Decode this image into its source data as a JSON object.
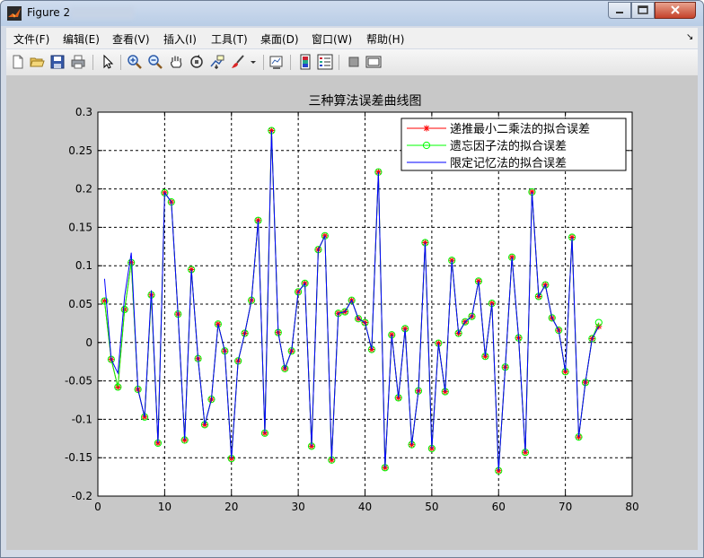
{
  "window": {
    "title": "Figure 2"
  },
  "menu": [
    {
      "label": "文件(F)"
    },
    {
      "label": "编辑(E)"
    },
    {
      "label": "查看(V)"
    },
    {
      "label": "插入(I)"
    },
    {
      "label": "工具(T)"
    },
    {
      "label": "桌面(D)"
    },
    {
      "label": "窗口(W)"
    },
    {
      "label": "帮助(H)"
    }
  ],
  "toolbar_icons": [
    "new-file-icon",
    "open-folder-icon",
    "save-icon",
    "print-icon",
    "pointer-icon",
    "zoom-in-icon",
    "zoom-out-icon",
    "pan-hand-icon",
    "rotate-3d-icon",
    "data-cursor-icon",
    "brush-icon",
    "brush-dropdown-icon",
    "link-plot-icon",
    "colorbar-icon",
    "legend-icon",
    "hide-plot-tools-icon",
    "show-plot-tools-icon"
  ],
  "colors": {
    "series1": "#ff0000",
    "series2": "#00ff00",
    "series3": "#0000ff",
    "figure_bg": "#c8c8c8",
    "axes_bg": "#ffffff"
  },
  "chart_data": {
    "type": "line",
    "title": "三种算法误差曲线图",
    "xlabel": "",
    "ylabel": "",
    "xlim": [
      0,
      80
    ],
    "ylim": [
      -0.2,
      0.3
    ],
    "xticks": [
      "0",
      "10",
      "20",
      "30",
      "40",
      "50",
      "60",
      "70",
      "80"
    ],
    "yticks": [
      "-0.2",
      "-0.15",
      "-0.1",
      "-0.05",
      "0",
      "0.05",
      "0.1",
      "0.15",
      "0.2",
      "0.25",
      "0.3"
    ],
    "grid": true,
    "legend_position": "top-right",
    "series": [
      {
        "name": "递推最小二乘法的拟合误差",
        "marker": "asterisk",
        "color": "#ff0000",
        "x": [
          1,
          2,
          3,
          4,
          5,
          6,
          7,
          8,
          9,
          10,
          11,
          12,
          13,
          14,
          15,
          16,
          17,
          18,
          19,
          20,
          21,
          22,
          23,
          24,
          25,
          26,
          27,
          28,
          29,
          30,
          31,
          32,
          33,
          34,
          35,
          36,
          37,
          38,
          39,
          40,
          41,
          42,
          43,
          44,
          45,
          46,
          47,
          48,
          49,
          50,
          51,
          52,
          53,
          54,
          55,
          56,
          57,
          58,
          59,
          60,
          61,
          62,
          63,
          64,
          65,
          66,
          67,
          68,
          69,
          70,
          71,
          72,
          73,
          74,
          75
        ],
        "y": [
          0.054,
          -0.022,
          -0.058,
          0.043,
          0.104,
          -0.061,
          -0.097,
          0.062,
          -0.131,
          0.195,
          0.183,
          0.037,
          -0.127,
          0.095,
          -0.021,
          -0.107,
          -0.074,
          0.024,
          -0.011,
          -0.151,
          -0.024,
          0.012,
          0.055,
          0.159,
          -0.118,
          0.276,
          0.013,
          -0.034,
          -0.011,
          0.066,
          0.077,
          -0.135,
          0.121,
          0.139,
          -0.153,
          0.038,
          0.04,
          0.055,
          0.031,
          0.026,
          -0.009,
          0.222,
          -0.163,
          0.01,
          -0.072,
          0.018,
          -0.133,
          -0.063,
          0.13,
          -0.138,
          -0.001,
          -0.064,
          0.107,
          0.012,
          0.027,
          0.034,
          0.08,
          -0.018,
          0.051,
          -0.167,
          -0.032,
          0.111,
          0.006,
          -0.143,
          0.196,
          0.06,
          0.075,
          0.032,
          0.016,
          -0.038,
          0.137,
          -0.123,
          -0.052,
          0.005,
          0.021
        ]
      },
      {
        "name": "遗忘因子法的拟合误差",
        "marker": "circle",
        "color": "#00ff00",
        "x": [
          1,
          2,
          3,
          4,
          5,
          6,
          7,
          8,
          9,
          10,
          11,
          12,
          13,
          14,
          15,
          16,
          17,
          18,
          19,
          20,
          21,
          22,
          23,
          24,
          25,
          26,
          27,
          28,
          29,
          30,
          31,
          32,
          33,
          34,
          35,
          36,
          37,
          38,
          39,
          40,
          41,
          42,
          43,
          44,
          45,
          46,
          47,
          48,
          49,
          50,
          51,
          52,
          53,
          54,
          55,
          56,
          57,
          58,
          59,
          60,
          61,
          62,
          63,
          64,
          65,
          66,
          67,
          68,
          69,
          70,
          71,
          72,
          73,
          74,
          75
        ],
        "y": [
          0.054,
          -0.022,
          -0.058,
          0.043,
          0.104,
          -0.061,
          -0.097,
          0.062,
          -0.131,
          0.195,
          0.183,
          0.037,
          -0.127,
          0.095,
          -0.021,
          -0.107,
          -0.074,
          0.024,
          -0.011,
          -0.151,
          -0.024,
          0.012,
          0.055,
          0.159,
          -0.118,
          0.276,
          0.013,
          -0.034,
          -0.011,
          0.066,
          0.077,
          -0.135,
          0.121,
          0.139,
          -0.153,
          0.038,
          0.04,
          0.055,
          0.031,
          0.026,
          -0.009,
          0.222,
          -0.163,
          0.01,
          -0.072,
          0.018,
          -0.133,
          -0.063,
          0.13,
          -0.138,
          -0.001,
          -0.064,
          0.107,
          0.012,
          0.027,
          0.034,
          0.08,
          -0.018,
          0.051,
          -0.167,
          -0.032,
          0.111,
          0.006,
          -0.143,
          0.196,
          0.06,
          0.075,
          0.032,
          0.016,
          -0.038,
          0.137,
          -0.123,
          -0.052,
          0.005,
          0.026
        ]
      },
      {
        "name": "限定记忆法的拟合误差",
        "marker": "none",
        "color": "#0000ff",
        "x": [
          1,
          2,
          3,
          4,
          5,
          6,
          7,
          8,
          9,
          10,
          11,
          12,
          13,
          14,
          15,
          16,
          17,
          18,
          19,
          20,
          21,
          22,
          23,
          24,
          25,
          26,
          27,
          28,
          29,
          30,
          31,
          32,
          33,
          34,
          35,
          36,
          37,
          38,
          39,
          40,
          41,
          42,
          43,
          44,
          45,
          46,
          47,
          48,
          49,
          50,
          51,
          52,
          53,
          54,
          55,
          56,
          57,
          58,
          59,
          60,
          61,
          62,
          63,
          64,
          65,
          66,
          67,
          68,
          69,
          70,
          71,
          72,
          73,
          74,
          75
        ],
        "y": [
          0.083,
          -0.022,
          -0.04,
          0.06,
          0.117,
          -0.061,
          -0.097,
          0.068,
          -0.131,
          0.195,
          0.183,
          0.037,
          -0.127,
          0.095,
          -0.021,
          -0.107,
          -0.074,
          0.024,
          -0.011,
          -0.151,
          -0.024,
          0.012,
          0.055,
          0.159,
          -0.118,
          0.276,
          0.013,
          -0.034,
          -0.011,
          0.066,
          0.077,
          -0.135,
          0.121,
          0.139,
          -0.153,
          0.038,
          0.04,
          0.055,
          0.031,
          0.026,
          -0.009,
          0.222,
          -0.163,
          0.01,
          -0.072,
          0.018,
          -0.133,
          -0.063,
          0.13,
          -0.138,
          -0.001,
          -0.064,
          0.107,
          0.012,
          0.027,
          0.034,
          0.08,
          -0.018,
          0.051,
          -0.167,
          -0.032,
          0.111,
          0.006,
          -0.143,
          0.196,
          0.06,
          0.075,
          0.032,
          0.016,
          -0.038,
          0.137,
          -0.123,
          -0.052,
          0.005,
          0.021
        ]
      }
    ]
  }
}
